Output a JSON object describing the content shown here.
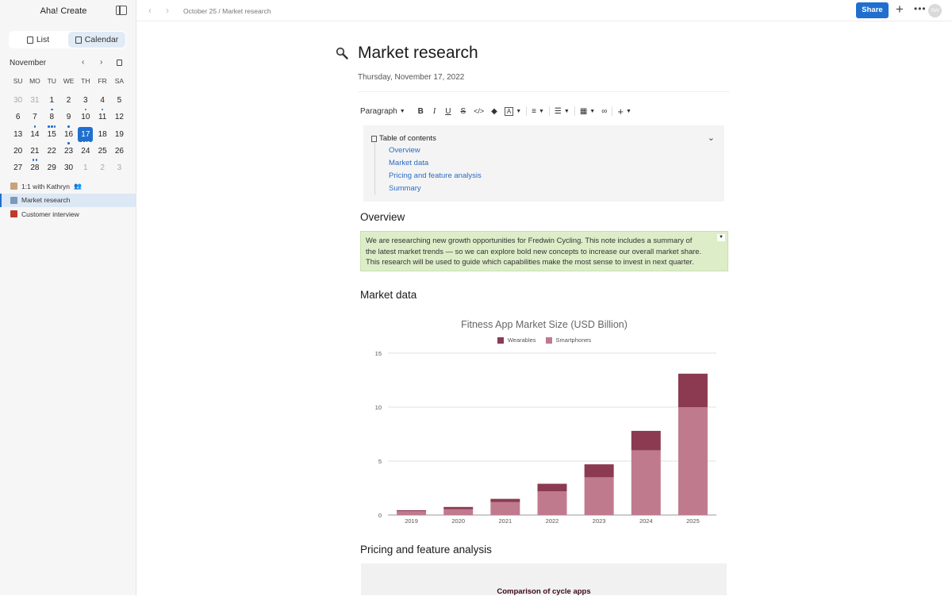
{
  "app": {
    "title": "Aha! Create"
  },
  "sidebar": {
    "view_switch": {
      "list_label": "List",
      "calendar_label": "Calendar"
    },
    "calendar": {
      "month": "November",
      "weekdays": [
        "SU",
        "MO",
        "TU",
        "WE",
        "TH",
        "FR",
        "SA"
      ],
      "weeks": [
        [
          {
            "d": "30",
            "muted": true,
            "dots": 0
          },
          {
            "d": "31",
            "muted": true,
            "dots": 0
          },
          {
            "d": "1",
            "dots": 1
          },
          {
            "d": "2",
            "dots": 0
          },
          {
            "d": "3",
            "dots": 1
          },
          {
            "d": "4",
            "dots": 1
          },
          {
            "d": "5",
            "dots": 0
          }
        ],
        [
          {
            "d": "6",
            "dots": 0
          },
          {
            "d": "7",
            "dots": 1
          },
          {
            "d": "8",
            "dots": 3
          },
          {
            "d": "9",
            "dots": 1
          },
          {
            "d": "10",
            "dots": 0
          },
          {
            "d": "11",
            "dots": 0
          },
          {
            "d": "12",
            "dots": 0
          }
        ],
        [
          {
            "d": "13",
            "dots": 0
          },
          {
            "d": "14",
            "dots": 0
          },
          {
            "d": "15",
            "dots": 0
          },
          {
            "d": "16",
            "dots": 1
          },
          {
            "d": "17",
            "dots": 3,
            "selected": true
          },
          {
            "d": "18",
            "dots": 0
          },
          {
            "d": "19",
            "dots": 0
          }
        ],
        [
          {
            "d": "20",
            "dots": 0
          },
          {
            "d": "21",
            "dots": 2
          },
          {
            "d": "22",
            "dots": 0
          },
          {
            "d": "23",
            "dots": 0
          },
          {
            "d": "24",
            "dots": 0
          },
          {
            "d": "25",
            "dots": 0
          },
          {
            "d": "26",
            "dots": 0
          }
        ],
        [
          {
            "d": "27",
            "dots": 0
          },
          {
            "d": "28",
            "dots": 0
          },
          {
            "d": "29",
            "dots": 0
          },
          {
            "d": "30",
            "dots": 0
          },
          {
            "d": "1",
            "muted": true,
            "dots": 0
          },
          {
            "d": "2",
            "muted": true,
            "dots": 0
          },
          {
            "d": "3",
            "muted": true,
            "dots": 0
          }
        ]
      ]
    },
    "notes": [
      {
        "label": "1:1 with Kathryn",
        "icon": "calendar-note-icon",
        "shared": true
      },
      {
        "label": "Market research",
        "icon": "magnifier-icon",
        "active": true
      },
      {
        "label": "Customer interview",
        "icon": "phone-icon"
      }
    ]
  },
  "topbar": {
    "breadcrumb": "October 25 / Market research",
    "share_label": "Share",
    "avatar_initials": "SW"
  },
  "document": {
    "title": "Market research",
    "date": "Thursday, November 17, 2022",
    "toolbar": {
      "paragraph_label": "Paragraph"
    },
    "toc": {
      "title": "Table of contents",
      "items": [
        "Overview",
        "Market data",
        "Pricing and feature analysis",
        "Summary"
      ]
    },
    "overview": {
      "heading": "Overview",
      "callout_lines": [
        "We are researching new growth opportunities for Fredwin Cycling. This note includes a summary of",
        "the latest market trends — so we can explore bold new concepts to increase our overall market share.",
        "This research will be used to guide which capabilities make the most sense to invest in next quarter."
      ]
    },
    "market_data": {
      "heading": "Market data"
    },
    "pricing": {
      "heading": "Pricing and feature analysis",
      "card_title": "Comparison of cycle apps"
    }
  },
  "colors": {
    "accent": "#1f6fcf",
    "wearables": "#8b3a52",
    "smartphones": "#c07a8e",
    "callout": "#dcedc8"
  },
  "chart_data": {
    "type": "bar",
    "stacked": true,
    "title": "Fitness App Market Size (USD Billion)",
    "categories": [
      "2019",
      "2020",
      "2021",
      "2022",
      "2023",
      "2024",
      "2025"
    ],
    "series": [
      {
        "name": "Smartphones",
        "values": [
          0.35,
          0.55,
          1.2,
          2.2,
          3.5,
          6.0,
          10.0
        ]
      },
      {
        "name": "Wearables",
        "values": [
          0.1,
          0.2,
          0.3,
          0.7,
          1.2,
          1.8,
          3.1
        ]
      }
    ],
    "ylim": [
      0,
      15
    ],
    "yticks": [
      0,
      5,
      10,
      15
    ],
    "legend_position": "top",
    "grid": true
  }
}
